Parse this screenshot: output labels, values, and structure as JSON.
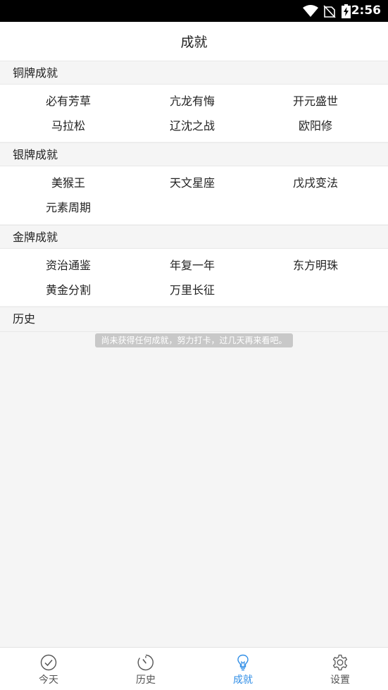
{
  "status_bar": {
    "time": "2:56"
  },
  "header": {
    "title": "成就"
  },
  "sections": {
    "bronze": {
      "title": "铜牌成就",
      "items": [
        "必有芳草",
        "亢龙有悔",
        "开元盛世",
        "马拉松",
        "辽沈之战",
        "欧阳修"
      ]
    },
    "silver": {
      "title": "银牌成就",
      "items": [
        "美猴王",
        "天文星座",
        "戊戌变法",
        "元素周期"
      ]
    },
    "gold": {
      "title": "金牌成就",
      "items": [
        "资治通鉴",
        "年复一年",
        "东方明珠",
        "黄金分割",
        "万里长征"
      ]
    },
    "history": {
      "title": "历史"
    }
  },
  "toast": {
    "text": "尚未获得任何成就，努力打卡，过几天再来看吧。"
  },
  "bottom_nav": {
    "items": [
      {
        "label": "今天",
        "icon": "check-circle-icon"
      },
      {
        "label": "历史",
        "icon": "timer-icon"
      },
      {
        "label": "成就",
        "icon": "lightbulb-icon",
        "active": true
      },
      {
        "label": "设置",
        "icon": "gear-icon"
      }
    ],
    "active_color": "#2e8de6"
  }
}
